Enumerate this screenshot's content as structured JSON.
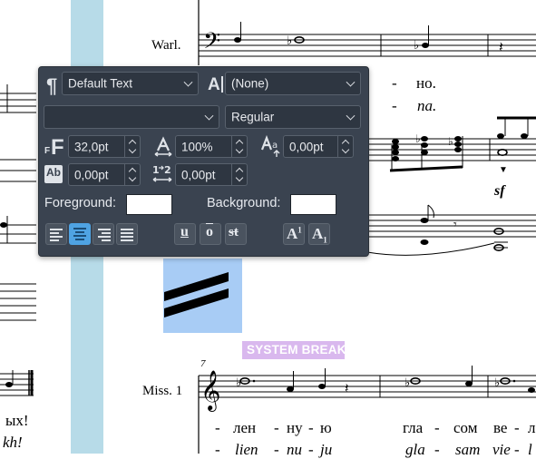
{
  "score": {
    "instrument_top": "Warl.",
    "instrument_bottom": "Miss. 1",
    "measure_number": "7",
    "system_break_label": "SYSTEM BREAK",
    "dynamic_mark": "sf",
    "lyrics_top_line1": [
      "-",
      "но."
    ],
    "lyrics_top_line2": [
      "-",
      "na."
    ],
    "lyrics_bottom_line1": [
      "-",
      "лен",
      "-",
      "ну",
      "-",
      "ю",
      "гла",
      "-",
      "сом",
      "ве",
      "-",
      "л"
    ],
    "lyrics_bottom_line2": [
      "-",
      "lien",
      "-",
      "nu",
      "-",
      "ju",
      "gla",
      "-",
      "sam",
      "vie",
      "-",
      "l"
    ],
    "left_fragment_line1": "ых!",
    "left_fragment_line2": "kh!"
  },
  "palette": {
    "style_select": "Default Text",
    "char_style_select": "(None)",
    "font_family_select": "",
    "font_style_select": "Regular",
    "font_size": "32,0pt",
    "line_spacing": "100%",
    "char_spacing": "0,00pt",
    "baseline_shift": "0,00pt",
    "frame_spacing": "0,00pt",
    "foreground_label": "Foreground:",
    "background_label": "Background:",
    "foreground_color": "#ffffff",
    "background_color": "#ffffff",
    "align_buttons": [
      "align-left",
      "align-center",
      "align-right",
      "align-justify"
    ],
    "selected_align": "align-center",
    "format_buttons": [
      "u",
      "o",
      "st"
    ],
    "script_buttons": [
      "A1",
      "A1"
    ]
  },
  "colors": {
    "palette_bg": "#3a4350",
    "accent": "#4fa3e3",
    "system_break": "#d9b8ee",
    "vertical_band": "#b7dbe8",
    "selection": "#a8ccf5"
  }
}
